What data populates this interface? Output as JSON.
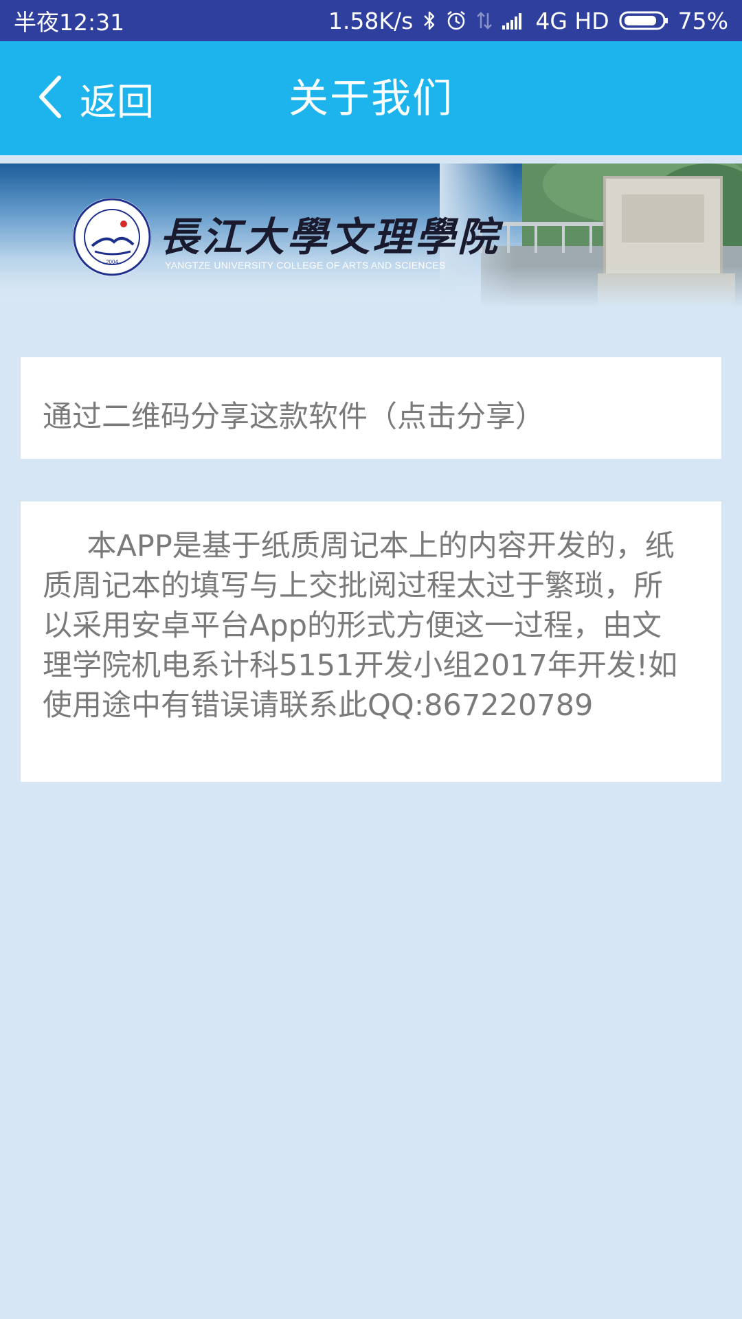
{
  "status_bar": {
    "time": "半夜12:31",
    "net_speed": "1.58K/s",
    "network": "4G HD",
    "battery": "75%",
    "icons": [
      "bluetooth-icon",
      "alarm-icon",
      "data-transfer-icon",
      "signal-icon",
      "battery-icon"
    ]
  },
  "header": {
    "back_label": "返回",
    "title": "关于我们"
  },
  "banner": {
    "school_name_cn": "長江大學文理學院",
    "school_name_en": "YANGTZE UNIVERSITY COLLEGE OF ARTS AND SCIENCES",
    "seal_year": "2004"
  },
  "share": {
    "label": "通过二维码分享这款软件（点击分享）"
  },
  "about": {
    "text": "本APP是基于纸质周记本上的内容开发的，纸质周记本的填写与上交批阅过程太过于繁琐，所以采用安卓平台App的形式方便这一过程，由文理学院机电系计科5151开发小组2017年开发!如使用途中有错误请联系此QQ:867220789"
  },
  "colors": {
    "status_bar": "#2f3f9e",
    "app_bar": "#1db4ee",
    "page_background": "#d6e6f4",
    "card": "#ffffff",
    "card_text": "#7a7a7a"
  }
}
